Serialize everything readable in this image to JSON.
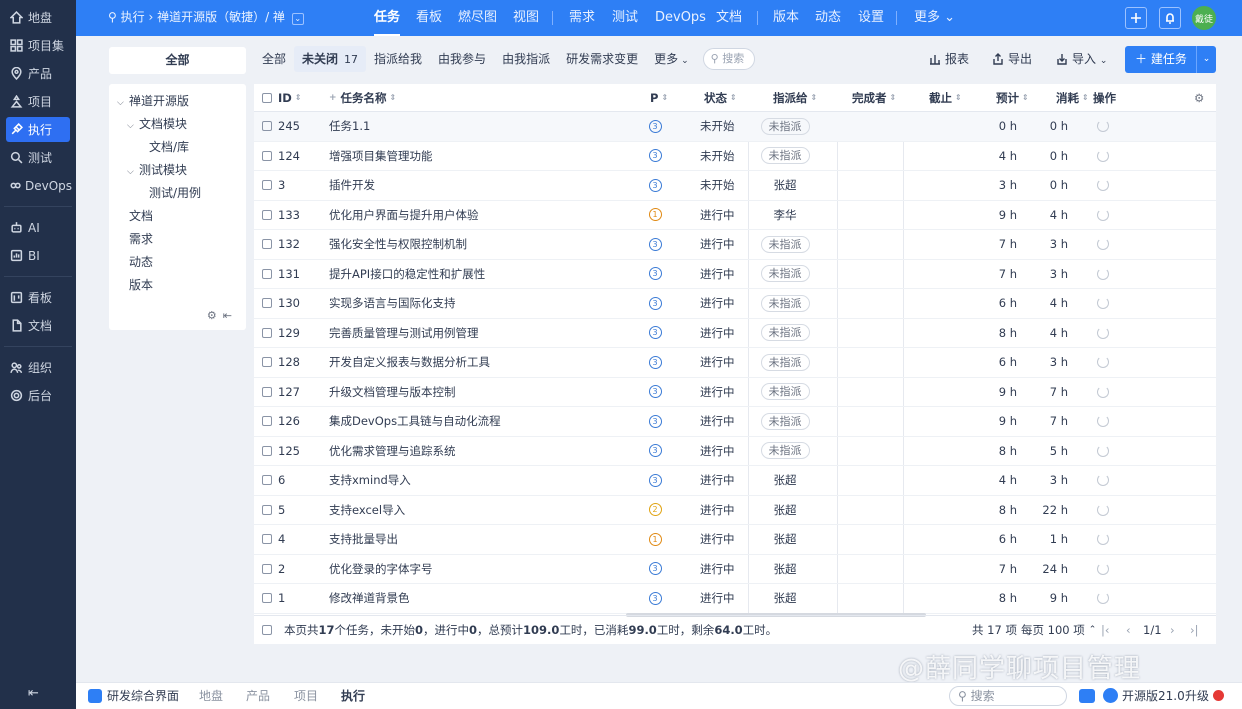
{
  "sidebar": {
    "items": [
      {
        "label": "地盘",
        "icon": "dashboard-icon"
      },
      {
        "label": "项目集",
        "icon": "grid-icon"
      },
      {
        "label": "产品",
        "icon": "product-icon"
      },
      {
        "label": "项目",
        "icon": "project-icon"
      },
      {
        "label": "执行",
        "icon": "execution-icon",
        "active": true
      },
      {
        "label": "测试",
        "icon": "test-icon"
      },
      {
        "label": "DevOps",
        "icon": "devops-icon"
      },
      {
        "label": "AI",
        "icon": "robot-icon"
      },
      {
        "label": "BI",
        "icon": "bi-icon"
      },
      {
        "label": "看板",
        "icon": "kanban-icon"
      },
      {
        "label": "文档",
        "icon": "doc-icon"
      },
      {
        "label": "组织",
        "icon": "org-icon"
      },
      {
        "label": "后台",
        "icon": "admin-icon"
      }
    ],
    "collapse_icon": "collapse-left-icon"
  },
  "topbar": {
    "breadcrumb": {
      "root": "执行",
      "path": "禅道开源版（敏捷）/ 禅"
    },
    "nav": [
      "任务",
      "看板",
      "燃尽图",
      "视图",
      "需求",
      "测试",
      "DevOps",
      "文档",
      "版本",
      "动态",
      "设置",
      "更多"
    ],
    "active": "任务",
    "avatar_text": "戴徒"
  },
  "leftpanel": {
    "all_label": "全部",
    "tree": [
      "禅道开源版",
      "文档模块",
      "文档/库",
      "测试模块",
      "测试/用例",
      "文档",
      "需求",
      "动态",
      "版本"
    ]
  },
  "tabs": [
    {
      "label": "全部"
    },
    {
      "label": "未关闭",
      "count": "17",
      "active": true
    },
    {
      "label": "指派给我"
    },
    {
      "label": "由我参与"
    },
    {
      "label": "由我指派"
    },
    {
      "label": "研发需求变更"
    },
    {
      "label": "更多"
    }
  ],
  "search_placeholder": "搜索",
  "toolbar": {
    "report": "报表",
    "export": "导出",
    "import": "导入",
    "create": "建任务"
  },
  "table": {
    "headers": {
      "id": "ID",
      "name": "任务名称",
      "pri": "P",
      "status": "状态",
      "assigned": "指派给",
      "finished": "完成者",
      "deadline": "截止",
      "estimate": "预计",
      "consumed": "消耗",
      "actions": "操作"
    },
    "rows": [
      {
        "id": "245",
        "name": "任务1.1",
        "pri": "3",
        "status": "未开始",
        "assigned": "未指派",
        "unassigned": true,
        "estimate": "0 h",
        "consumed": "0 h"
      },
      {
        "id": "124",
        "name": "增强项目集管理功能",
        "pri": "3",
        "status": "未开始",
        "assigned": "未指派",
        "unassigned": true,
        "estimate": "4 h",
        "consumed": "0 h"
      },
      {
        "id": "3",
        "name": "插件开发",
        "pri": "3",
        "status": "未开始",
        "assigned": "张超",
        "estimate": "3 h",
        "consumed": "0 h"
      },
      {
        "id": "133",
        "name": "优化用户界面与提升用户体验",
        "pri": "1",
        "status": "进行中",
        "assigned": "李华",
        "estimate": "9 h",
        "consumed": "4 h"
      },
      {
        "id": "132",
        "name": "强化安全性与权限控制机制",
        "pri": "3",
        "status": "进行中",
        "assigned": "未指派",
        "unassigned": true,
        "estimate": "7 h",
        "consumed": "3 h"
      },
      {
        "id": "131",
        "name": "提升API接口的稳定性和扩展性",
        "pri": "3",
        "status": "进行中",
        "assigned": "未指派",
        "unassigned": true,
        "estimate": "7 h",
        "consumed": "3 h"
      },
      {
        "id": "130",
        "name": "实现多语言与国际化支持",
        "pri": "3",
        "status": "进行中",
        "assigned": "未指派",
        "unassigned": true,
        "estimate": "6 h",
        "consumed": "4 h"
      },
      {
        "id": "129",
        "name": "完善质量管理与测试用例管理",
        "pri": "3",
        "status": "进行中",
        "assigned": "未指派",
        "unassigned": true,
        "estimate": "8 h",
        "consumed": "4 h"
      },
      {
        "id": "128",
        "name": "开发自定义报表与数据分析工具",
        "pri": "3",
        "status": "进行中",
        "assigned": "未指派",
        "unassigned": true,
        "estimate": "6 h",
        "consumed": "3 h"
      },
      {
        "id": "127",
        "name": "升级文档管理与版本控制",
        "pri": "3",
        "status": "进行中",
        "assigned": "未指派",
        "unassigned": true,
        "estimate": "9 h",
        "consumed": "7 h"
      },
      {
        "id": "126",
        "name": "集成DevOps工具链与自动化流程",
        "pri": "3",
        "status": "进行中",
        "assigned": "未指派",
        "unassigned": true,
        "estimate": "9 h",
        "consumed": "7 h"
      },
      {
        "id": "125",
        "name": "优化需求管理与追踪系统",
        "pri": "3",
        "status": "进行中",
        "assigned": "未指派",
        "unassigned": true,
        "estimate": "8 h",
        "consumed": "5 h"
      },
      {
        "id": "6",
        "name": "支持xmind导入",
        "pri": "3",
        "status": "进行中",
        "assigned": "张超",
        "estimate": "4 h",
        "consumed": "3 h"
      },
      {
        "id": "5",
        "name": "支持excel导入",
        "pri": "2",
        "status": "进行中",
        "assigned": "张超",
        "estimate": "8 h",
        "consumed": "22 h"
      },
      {
        "id": "4",
        "name": "支持批量导出",
        "pri": "1",
        "status": "进行中",
        "assigned": "张超",
        "estimate": "6 h",
        "consumed": "1 h"
      },
      {
        "id": "2",
        "name": "优化登录的字体字号",
        "pri": "3",
        "status": "进行中",
        "assigned": "张超",
        "estimate": "7 h",
        "consumed": "24 h"
      },
      {
        "id": "1",
        "name": "修改禅道背景色",
        "pri": "3",
        "status": "进行中",
        "assigned": "张超",
        "estimate": "8 h",
        "consumed": "9 h"
      }
    ],
    "footer": {
      "summary_pre": "本页共 ",
      "summary_count": "17",
      "summary_mid1": " 个任务，未开始 ",
      "summary_wait": "0",
      "summary_mid2": "，进行中 ",
      "summary_doing": "0",
      "summary_mid3": "，总预计 ",
      "summary_est": "109.0",
      "summary_mid4": " 工时，已消耗 ",
      "summary_cons": "99.0",
      "summary_mid5": " 工时，剩余 ",
      "summary_left": "64.0",
      "summary_end": " 工时。",
      "total": "共 17 项",
      "per_page": "每页 100 项",
      "page": "1/1"
    }
  },
  "bottombar": {
    "app": "研发综合界面",
    "tabs": [
      "地盘",
      "产品",
      "项目",
      "执行"
    ],
    "active": "执行",
    "search": "搜索",
    "version": "开源版21.0",
    "upgrade": "升级"
  },
  "watermark": "@薛同学聊项目管理",
  "colors": {
    "primary": "#2e7ff5",
    "sidebar": "#22304a"
  }
}
